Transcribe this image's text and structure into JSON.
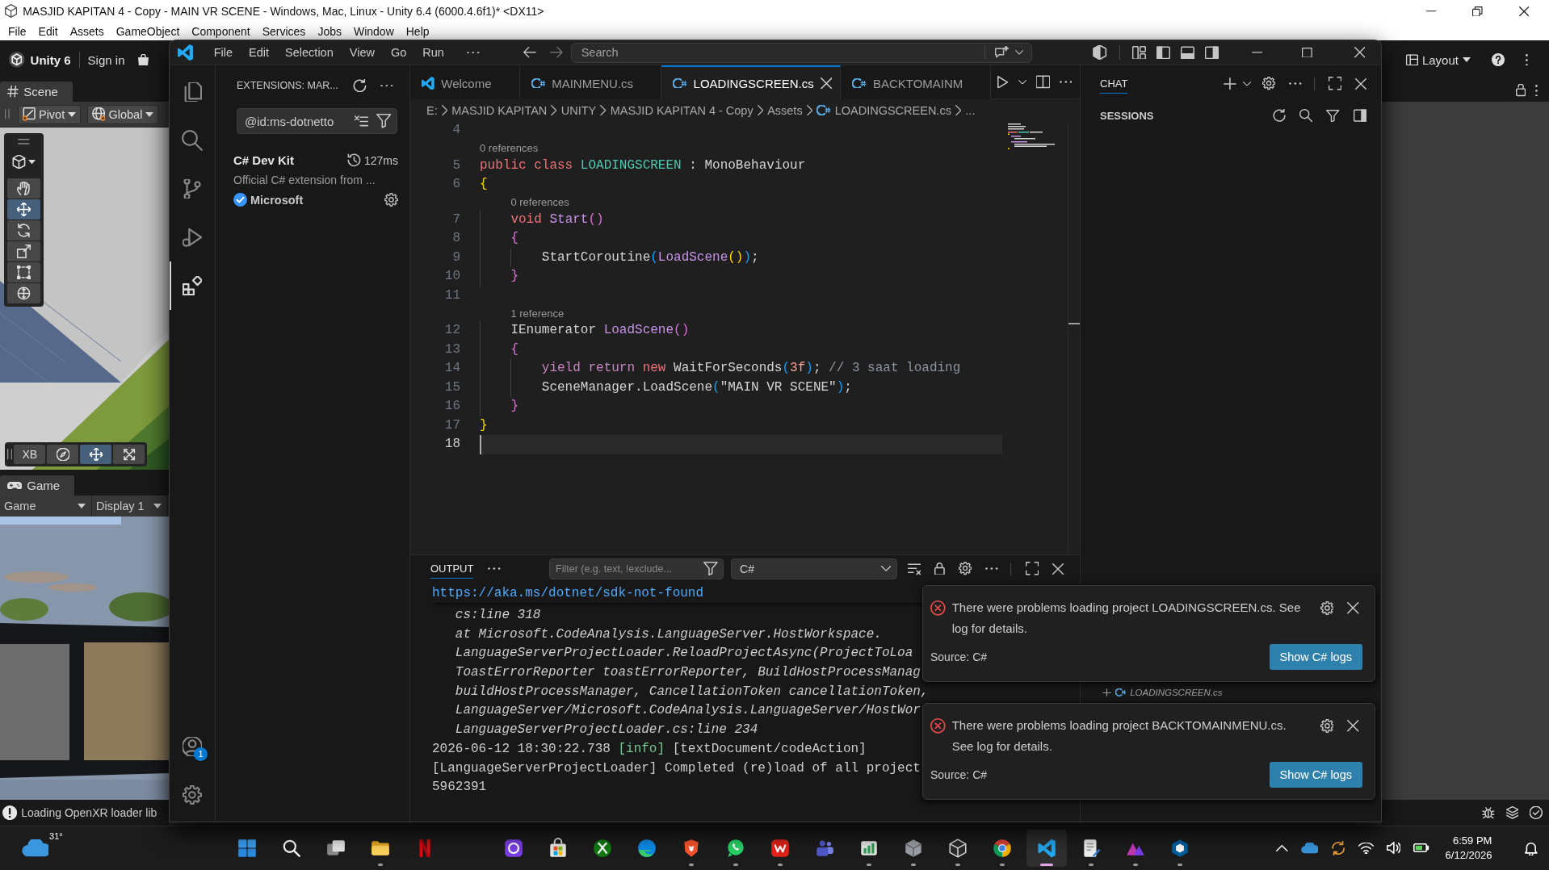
{
  "unity": {
    "title": "MASJID KAPITAN 4 - Copy - MAIN VR SCENE - Windows, Mac, Linux - Unity 6.4 (6000.4.6f1)* <DX11>",
    "menu": [
      "File",
      "Edit",
      "Assets",
      "GameObject",
      "Component",
      "Services",
      "Jobs",
      "Window",
      "Help"
    ],
    "toolbar": {
      "product": "Unity 6",
      "sign_in": "Sign in",
      "layout": "Layout"
    },
    "scene": {
      "tab": "Scene",
      "pivot": "Pivot",
      "space": "Global",
      "tools": [
        {
          "kind": "view",
          "selected": false
        },
        {
          "kind": "hand",
          "selected": false
        },
        {
          "kind": "move",
          "selected": true
        },
        {
          "kind": "rotate",
          "selected": false
        },
        {
          "kind": "scale",
          "selected": false
        },
        {
          "kind": "rect",
          "selected": false
        },
        {
          "kind": "transform",
          "selected": false
        }
      ],
      "overlay": [
        {
          "kind": "label",
          "label": "XB",
          "selected": false
        },
        {
          "kind": "compass",
          "selected": false
        },
        {
          "kind": "move",
          "selected": true
        },
        {
          "kind": "snap",
          "selected": false
        }
      ]
    },
    "game": {
      "tab": "Game",
      "view": "Game",
      "display": "Display 1"
    },
    "status": "Loading OpenXR loader lib"
  },
  "vscode": {
    "menu": [
      "File",
      "Edit",
      "Selection",
      "View",
      "Go",
      "Run"
    ],
    "search": {
      "placeholder": "Search"
    },
    "activity": [
      {
        "kind": "explorer",
        "selected": false
      },
      {
        "kind": "search",
        "selected": false
      },
      {
        "kind": "scm",
        "selected": false
      },
      {
        "kind": "debug",
        "selected": false
      },
      {
        "kind": "extensions",
        "selected": true
      }
    ],
    "account_badge": "1",
    "sidebar": {
      "title": "EXTENSIONS: MAR...",
      "query": "@id:ms-dotnetto",
      "extensions": [
        {
          "name": "C# Dev Kit",
          "time": "127ms",
          "description": "Official C# extension from ...",
          "publisher": "Microsoft",
          "verified": true
        }
      ]
    },
    "tabs": [
      {
        "label": "Welcome",
        "kind": "welcome",
        "selected": false
      },
      {
        "label": "MAINMENU.cs",
        "kind": "csharp",
        "selected": false
      },
      {
        "label": "LOADINGSCREEN.cs",
        "kind": "csharp",
        "selected": true
      },
      {
        "label": "BACKTOMAINM",
        "kind": "csharp",
        "selected": false
      }
    ],
    "breadcrumbs": [
      {
        "label": "E:",
        "kind": "folder"
      },
      {
        "label": "MASJID KAPITAN",
        "kind": "folder"
      },
      {
        "label": "UNITY",
        "kind": "folder"
      },
      {
        "label": "MASJID KAPITAN 4 - Copy",
        "kind": "folder"
      },
      {
        "label": "Assets",
        "kind": "folder"
      },
      {
        "label": "LOADINGSCREEN.cs",
        "kind": "csharp"
      },
      {
        "label": "...",
        "kind": "folder"
      }
    ],
    "code": [
      {
        "number": "4",
        "current": false
      },
      {
        "number": "5",
        "lens": "0 references",
        "tokens": [
          {
            "text": "public class ",
            "kind": "keyword"
          },
          {
            "text": "LOADINGSCREEN",
            "kind": "type"
          },
          {
            "text": " : MonoBehaviour",
            "kind": "plain"
          }
        ],
        "current": false
      },
      {
        "number": "6",
        "tokens": [
          {
            "text": "{",
            "kind": "bracket1"
          }
        ],
        "current": false
      },
      {
        "number": "7",
        "lens": "0 references",
        "tokens": [
          {
            "text": "    void ",
            "kind": "keyword"
          },
          {
            "text": "Start",
            "kind": "method"
          },
          {
            "text": "()",
            "kind": "bracket2"
          }
        ],
        "current": false
      },
      {
        "number": "8",
        "tokens": [
          {
            "text": "    {",
            "kind": "bracket2"
          }
        ],
        "current": false
      },
      {
        "number": "9",
        "tokens": [
          {
            "text": "        StartCoroutine",
            "kind": "plain"
          },
          {
            "text": "(",
            "kind": "bracket3"
          },
          {
            "text": "LoadScene",
            "kind": "method"
          },
          {
            "text": "()",
            "kind": "bracket1"
          },
          {
            "text": ")",
            "kind": "bracket3"
          },
          {
            "text": ";",
            "kind": "plain"
          }
        ],
        "current": false
      },
      {
        "number": "10",
        "tokens": [
          {
            "text": "    }",
            "kind": "bracket2"
          }
        ],
        "current": false
      },
      {
        "number": "11",
        "current": false
      },
      {
        "number": "12",
        "lens": "1 reference",
        "tokens": [
          {
            "text": "    IEnumerator ",
            "kind": "plain"
          },
          {
            "text": "LoadScene",
            "kind": "method"
          },
          {
            "text": "()",
            "kind": "bracket2"
          }
        ],
        "current": false
      },
      {
        "number": "13",
        "tokens": [
          {
            "text": "    {",
            "kind": "bracket2"
          }
        ],
        "current": false
      },
      {
        "number": "14",
        "tokens": [
          {
            "text": "        yield return ",
            "kind": "control"
          },
          {
            "text": "new ",
            "kind": "keyword"
          },
          {
            "text": "WaitForSeconds",
            "kind": "plain"
          },
          {
            "text": "(",
            "kind": "bracket3"
          },
          {
            "text": "3f",
            "kind": "number"
          },
          {
            "text": ")",
            "kind": "bracket3"
          },
          {
            "text": "; ",
            "kind": "plain"
          },
          {
            "text": "// 3 saat loading",
            "kind": "comment"
          }
        ],
        "current": false
      },
      {
        "number": "15",
        "tokens": [
          {
            "text": "        SceneManager.LoadScene",
            "kind": "plain"
          },
          {
            "text": "(",
            "kind": "bracket3"
          },
          {
            "text": "\"MAIN VR SCENE\"",
            "kind": "string"
          },
          {
            "text": ")",
            "kind": "bracket3"
          },
          {
            "text": ";",
            "kind": "plain"
          }
        ],
        "current": false
      },
      {
        "number": "16",
        "tokens": [
          {
            "text": "    }",
            "kind": "bracket2"
          }
        ],
        "current": false
      },
      {
        "number": "17",
        "tokens": [
          {
            "text": "}",
            "kind": "bracket1"
          }
        ],
        "current": false
      },
      {
        "number": "18",
        "current": true
      }
    ],
    "panel": {
      "tabs": [
        {
          "label": "OUTPUT",
          "selected": true
        }
      ],
      "filter": {
        "placeholder": "Filter (e.g. text, !exclude..."
      },
      "channel": "C#",
      "link": "https://aka.ms/dotnet/sdk-not-found",
      "lines": [
        {
          "kind": "trace",
          "parts": [
            {
              "text": "cs:line 318",
              "kind": "plain"
            }
          ]
        },
        {
          "kind": "trace",
          "parts": [
            {
              "text": "at Microsoft.CodeAnalysis.LanguageServer.HostWorkspace.",
              "kind": "plain"
            }
          ]
        },
        {
          "kind": "trace",
          "parts": [
            {
              "text": "LanguageServerProjectLoader.ReloadProjectAsync(ProjectToLoa",
              "kind": "plain"
            }
          ]
        },
        {
          "kind": "trace",
          "parts": [
            {
              "text": "ToastErrorReporter toastErrorReporter, BuildHostProcessManag",
              "kind": "plain"
            }
          ]
        },
        {
          "kind": "trace",
          "parts": [
            {
              "text": "buildHostProcessManager, CancellationToken cancellationToken,",
              "kind": "plain"
            }
          ]
        },
        {
          "kind": "trace",
          "parts": [
            {
              "text": "LanguageServer/Microsoft.CodeAnalysis.LanguageServer/HostWor",
              "kind": "plain"
            }
          ]
        },
        {
          "kind": "trace",
          "parts": [
            {
              "text": "LanguageServerProjectLoader.cs:line 234",
              "kind": "plain"
            }
          ]
        },
        {
          "kind": "log",
          "parts": [
            {
              "text": "2026-06-12 18:30:22.738 ",
              "kind": "plain"
            },
            {
              "text": "[info]",
              "kind": "info"
            },
            {
              "text": " [textDocument/codeAction]",
              "kind": "plain"
            }
          ]
        },
        {
          "kind": "log",
          "parts": [
            {
              "text": "[LanguageServerProjectLoader] Completed (re)load of all project",
              "kind": "plain"
            }
          ]
        },
        {
          "kind": "log",
          "parts": [
            {
              "text": "5962391",
              "kind": "plain"
            }
          ]
        }
      ]
    },
    "chat": {
      "tabs": [
        {
          "label": "CHAT",
          "selected": true
        }
      ],
      "sessions": "SESSIONS",
      "attachment": "LOADINGSCREEN.cs"
    },
    "notifications": [
      {
        "message": "There were problems loading project LOADINGSCREEN.cs. See log for details.",
        "source": "Source: C#",
        "action": "Show C# logs"
      },
      {
        "message": "There were problems loading project BACKTOMAINMENU.cs. See log for details.",
        "source": "Source: C#",
        "action": "Show C# logs"
      }
    ]
  },
  "taskbar": {
    "weather": "31°",
    "apps": [
      {
        "kind": "start",
        "running": false,
        "selected": false
      },
      {
        "kind": "search",
        "running": false,
        "selected": false
      },
      {
        "kind": "taskview",
        "running": false,
        "selected": false
      },
      {
        "kind": "folder",
        "running": true,
        "selected": false
      },
      {
        "kind": "nletter",
        "running": false,
        "selected": false
      },
      {
        "kind": "ringtile",
        "running": false,
        "selected": false
      },
      {
        "kind": "store",
        "running": false,
        "selected": false
      },
      {
        "kind": "xball",
        "running": false,
        "selected": false
      },
      {
        "kind": "wave",
        "running": false,
        "selected": false
      },
      {
        "kind": "shield",
        "running": true,
        "selected": false
      },
      {
        "kind": "bubble",
        "running": true,
        "selected": false
      },
      {
        "kind": "wtile",
        "running": true,
        "selected": false
      },
      {
        "kind": "people",
        "running": false,
        "selected": false
      },
      {
        "kind": "chart",
        "running": true,
        "selected": false
      },
      {
        "kind": "hub",
        "running": true,
        "selected": false
      },
      {
        "kind": "cube",
        "running": true,
        "selected": false
      },
      {
        "kind": "chrome",
        "running": true,
        "selected": false
      },
      {
        "kind": "code",
        "running": true,
        "selected": true
      },
      {
        "kind": "doc",
        "running": true,
        "selected": false
      },
      {
        "kind": "tri",
        "running": true,
        "selected": false
      },
      {
        "kind": "box",
        "running": true,
        "selected": false
      }
    ],
    "time": "6:59 PM",
    "date": "6/12/2026"
  }
}
